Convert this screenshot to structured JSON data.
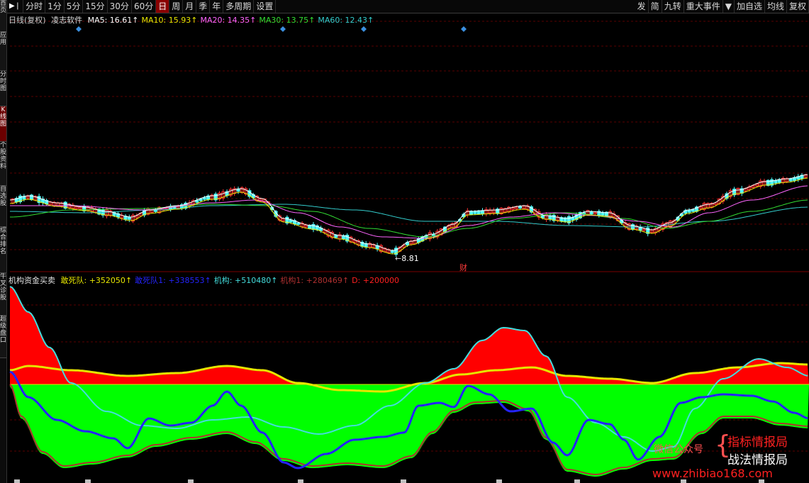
{
  "sidebar": {
    "tabs": [
      "首页",
      "应用",
      "分时图",
      "K线图",
      "个股资料",
      "自选股",
      "综合排名",
      "牛叉诊股",
      "超级盘口"
    ],
    "active_index": 3
  },
  "toolbar": {
    "nav_arrow": "▶❘",
    "periods": [
      "分时",
      "1分",
      "5分",
      "15分",
      "30分",
      "60分",
      "日",
      "周",
      "月",
      "季",
      "年",
      "多周期",
      "设置"
    ],
    "active_period": "日",
    "right_buttons": [
      "发",
      "简",
      "九转",
      "重大事件",
      "▼",
      "加自选",
      "均线",
      "复权"
    ]
  },
  "price_panel": {
    "title": "日线(复权)",
    "software": "凌志软件",
    "ma": [
      {
        "label": "MA5: 16.61",
        "arrow": "↑",
        "color": "#ffffff"
      },
      {
        "label": "MA10: 15.93",
        "arrow": "↑",
        "color": "#e6e600"
      },
      {
        "label": "MA20: 14.35",
        "arrow": "↑",
        "color": "#ff66ff"
      },
      {
        "label": "MA30: 13.75",
        "arrow": "↑",
        "color": "#33dd33"
      },
      {
        "label": "MA60: 12.43",
        "arrow": "↑",
        "color": "#33cccc"
      }
    ],
    "low_label": "8.81",
    "event_label": "财"
  },
  "indicator_panel": {
    "title": "机构资金买卖",
    "items": [
      {
        "label": "敢死队: +352050",
        "arrow": "↑",
        "color": "#e6e600"
      },
      {
        "label": "敢死队1: +338553",
        "arrow": "↑",
        "color": "#2424ff"
      },
      {
        "label": "机构: +510480",
        "arrow": "↑",
        "color": "#44dddd"
      },
      {
        "label": "机构1: +280469",
        "arrow": "↑",
        "color": "#b03030"
      },
      {
        "label": "D: +200000",
        "arrow": "",
        "color": "#ff2020"
      }
    ]
  },
  "watermark": {
    "wechat": "微信公众号",
    "brace": "{",
    "line1": "指标情报局",
    "line2": "战法情报局",
    "url": "www.zhibiao168.com"
  },
  "colors": {
    "up": "#ff3232",
    "down": "#54ffff",
    "grid": "#5a0000",
    "fill_red": "#ff0000",
    "fill_green": "#00ff00",
    "marker": "#3b8fe0"
  }
}
